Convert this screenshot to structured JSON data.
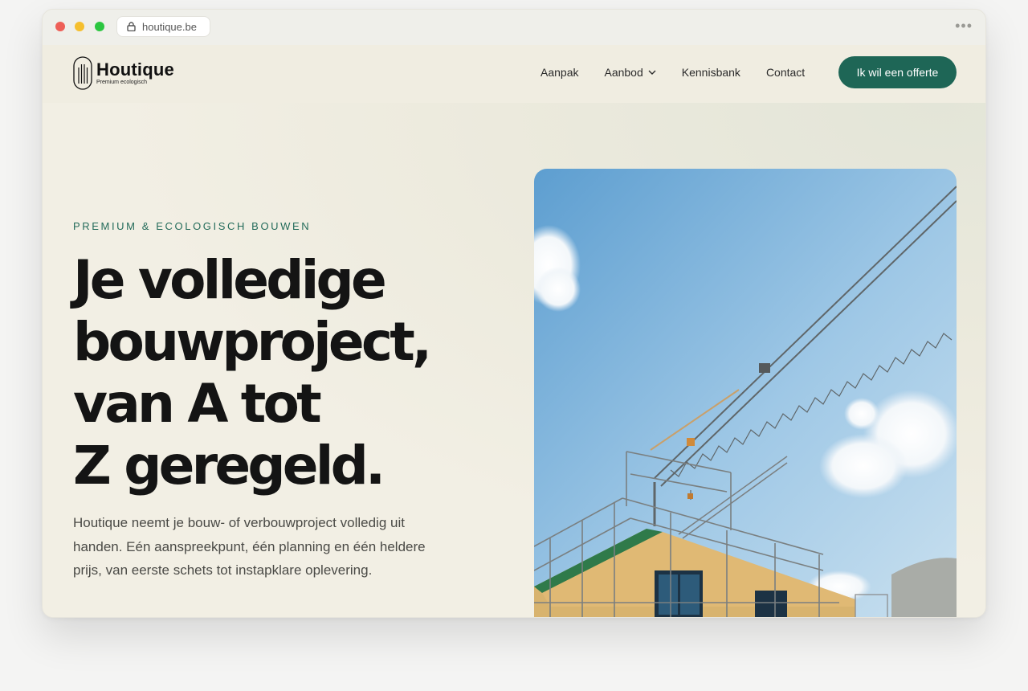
{
  "browser": {
    "url": "houtique.be",
    "menu": "•••"
  },
  "brand": {
    "name": "Houtique",
    "tagline": "Premium ecologisch"
  },
  "nav": {
    "items": [
      {
        "label": "Aanpak"
      },
      {
        "label": "Aanbod",
        "has_dropdown": true
      },
      {
        "label": "Kennisbank"
      },
      {
        "label": "Contact"
      }
    ],
    "cta": "Ik wil een offerte"
  },
  "hero": {
    "eyebrow": "PREMIUM & ECOLOGISCH BOUWEN",
    "headline_lines": [
      "Je volledige",
      "bouwproject,",
      "van A tot",
      "Z geregeld."
    ],
    "lede": "Houtique neemt je bouw- of verbouwproject volledig uit handen. Eén aanspreekpunt, één planning en één heldere prijs, van eerste schets tot instapklare oplevering."
  },
  "colors": {
    "accent": "#1e6656",
    "eyebrow": "#236b5a",
    "page_bg": "#f2efe4",
    "headline": "#141414"
  },
  "icons": {
    "lock": "lock-icon",
    "chevron": "chevron-down-icon"
  }
}
